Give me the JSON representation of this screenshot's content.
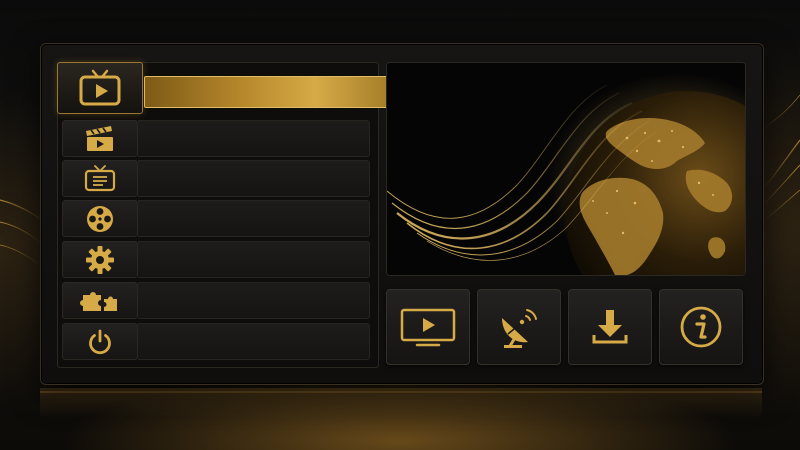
{
  "theme": {
    "accent": "#d6aa46",
    "accent_dark": "#7d5a17",
    "background": "#0b0b0b",
    "panel": "#161514"
  },
  "menu": {
    "items": [
      {
        "icon": "retro-tv-icon",
        "label": "",
        "selected": true
      },
      {
        "icon": "clapperboard-icon",
        "label": "",
        "selected": false
      },
      {
        "icon": "tv-guide-icon",
        "label": "",
        "selected": false
      },
      {
        "icon": "film-reel-icon",
        "label": "",
        "selected": false
      },
      {
        "icon": "gear-icon",
        "label": "",
        "selected": false
      },
      {
        "icon": "puzzle-icon",
        "label": "",
        "selected": false
      },
      {
        "icon": "power-icon",
        "label": "",
        "selected": false
      }
    ]
  },
  "preview": {
    "image": "globe-illustration"
  },
  "tiles": [
    {
      "icon": "monitor-play-icon"
    },
    {
      "icon": "satellite-dish-icon"
    },
    {
      "icon": "download-icon"
    },
    {
      "icon": "info-icon"
    }
  ]
}
